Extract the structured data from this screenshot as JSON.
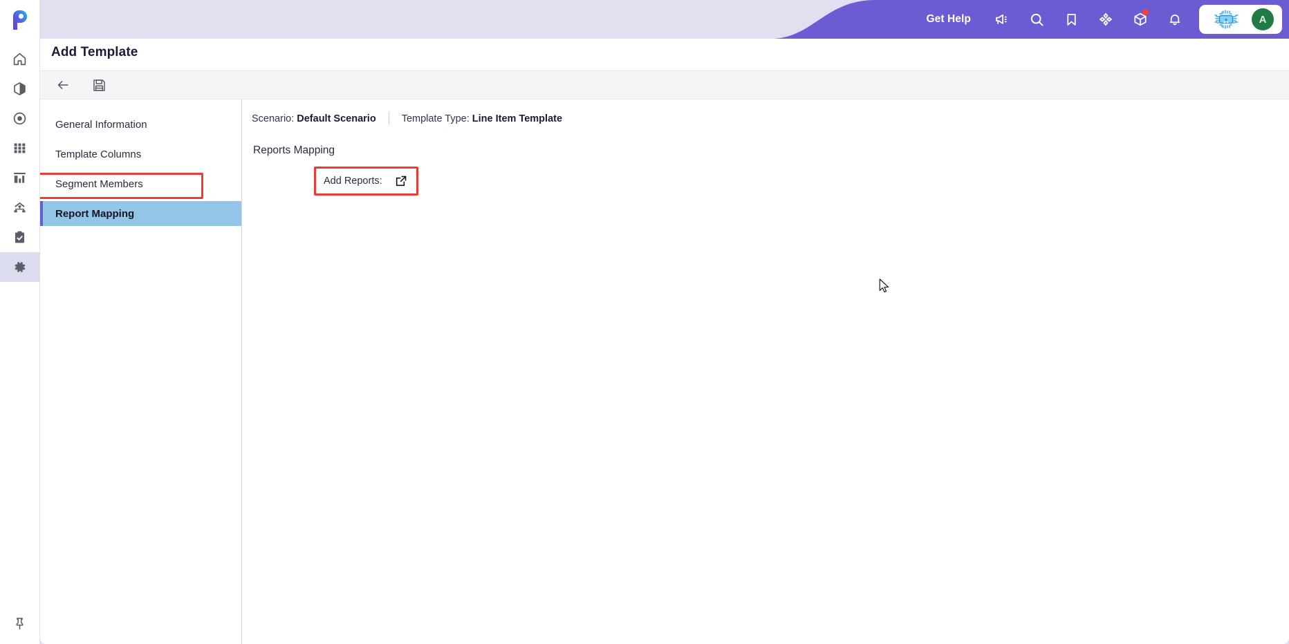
{
  "brand": {
    "logo_letter": "P",
    "accent_purple": "#6C5CD4",
    "banner_lavender": "#E3DEF0",
    "selected_nav_blue": "#93C5E8",
    "annotation_red": "#EC3C34"
  },
  "rail": {
    "items": [
      {
        "name": "home-icon",
        "label": "Home"
      },
      {
        "name": "cube-icon",
        "label": "Models"
      },
      {
        "name": "target-icon",
        "label": "Actuals"
      },
      {
        "name": "grid-icon",
        "label": "Grid"
      },
      {
        "name": "bar-chart-icon",
        "label": "Reports"
      },
      {
        "name": "hierarchy-icon",
        "label": "Hierarchy"
      },
      {
        "name": "clipboard-check-icon",
        "label": "Tasks"
      },
      {
        "name": "gear-icon",
        "label": "Settings",
        "active": true
      }
    ],
    "bottom": {
      "name": "pin-icon",
      "label": "Pin"
    }
  },
  "topbar": {
    "get_help_label": "Get Help",
    "icons": [
      {
        "name": "megaphone-icon",
        "label": "Announcements"
      },
      {
        "name": "search-icon",
        "label": "Search"
      },
      {
        "name": "bookmark-icon",
        "label": "Bookmarks"
      },
      {
        "name": "focus-target-icon",
        "label": "Focus"
      },
      {
        "name": "package-box-icon",
        "label": "What's New",
        "badge": true
      },
      {
        "name": "bell-icon",
        "label": "Notifications"
      }
    ],
    "user_pill": {
      "chip_icon": "ai-chip-icon",
      "avatar_initial": "A"
    }
  },
  "page": {
    "title": "Add Template"
  },
  "toolbar": {
    "buttons": [
      {
        "name": "back-button",
        "icon": "arrow-left-icon",
        "label": "Back"
      },
      {
        "name": "save-button",
        "icon": "floppy-disk-icon",
        "label": "Save"
      }
    ]
  },
  "nav_panel": {
    "items": [
      {
        "label": "General Information",
        "selected": false
      },
      {
        "label": "Template Columns",
        "selected": false
      },
      {
        "label": "Segment Members",
        "selected": false
      },
      {
        "label": "Report Mapping",
        "selected": true
      }
    ]
  },
  "content": {
    "meta": {
      "scenario_label": "Scenario:",
      "scenario_value": "Default Scenario",
      "template_type_label": "Template Type:",
      "template_type_value": "Line Item Template"
    },
    "section_title": "Reports Mapping",
    "add_reports": {
      "label": "Add Reports:",
      "icon": "external-link-icon"
    }
  }
}
